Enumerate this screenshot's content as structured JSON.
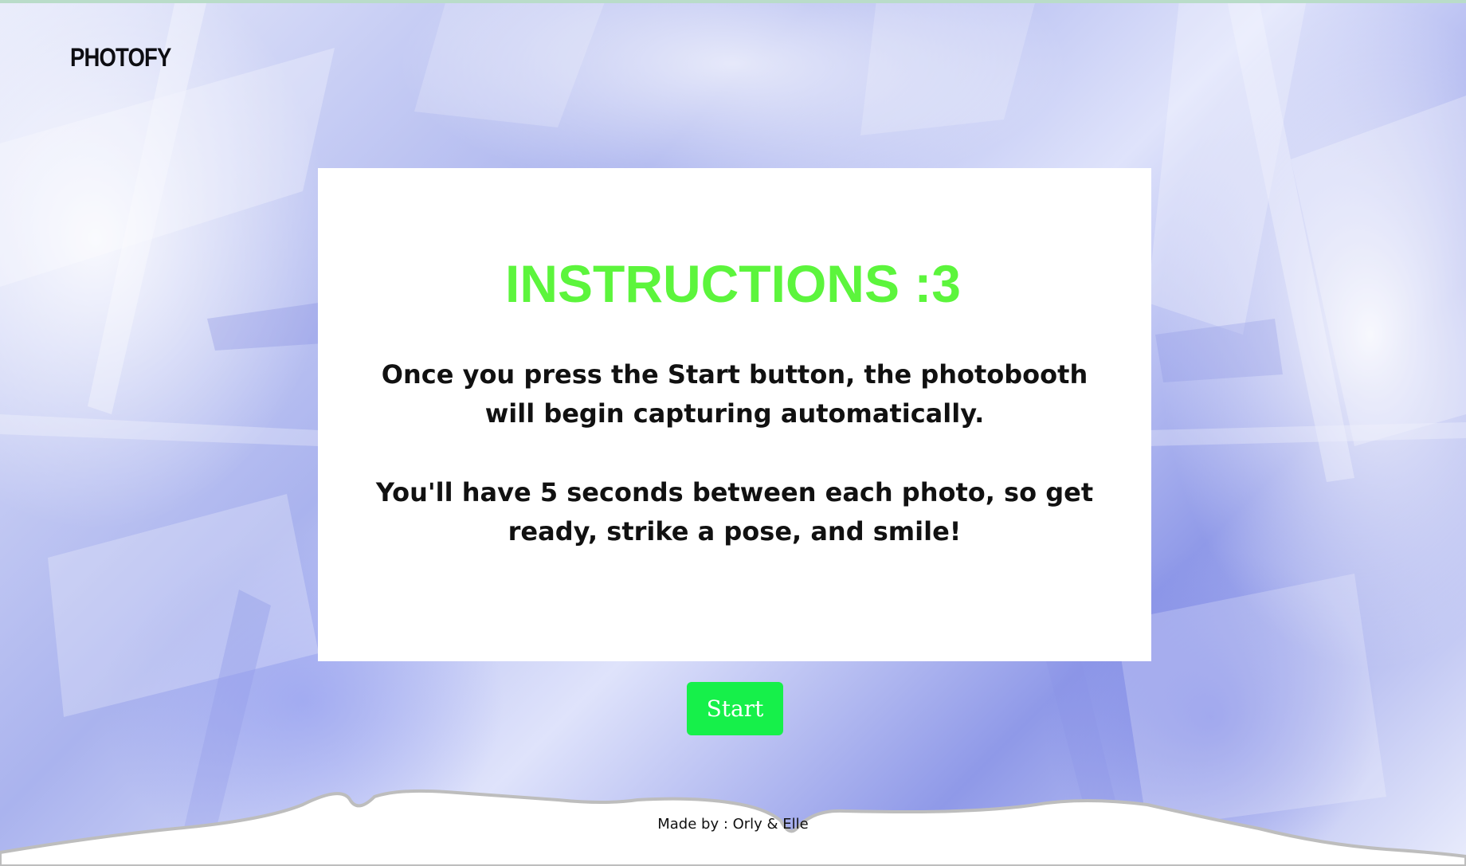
{
  "app": {
    "logo": "PHOTOFY"
  },
  "instructions": {
    "title": "INSTRUCTIONS :3",
    "paragraph_1": "Once you press the Start button, the photobooth will begin capturing automatically.",
    "paragraph_2": "You'll have 5 seconds between each photo, so get ready, strike a pose, and smile!"
  },
  "actions": {
    "start_label": "Start"
  },
  "footer": {
    "credits": "Made by : Orly & Elle"
  },
  "colors": {
    "title": "#5cf53c",
    "start_button": "#16f04a",
    "card": "#ffffff",
    "background_tint": "#aab3ee"
  }
}
